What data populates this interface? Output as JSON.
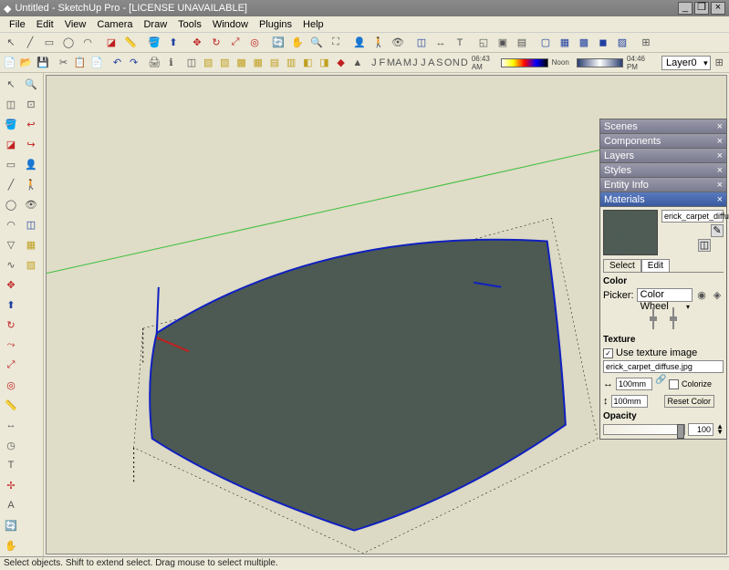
{
  "title": "Untitled - SketchUp Pro - [LICENSE UNAVAILABLE]",
  "menus": [
    "File",
    "Edit",
    "View",
    "Camera",
    "Draw",
    "Tools",
    "Window",
    "Plugins",
    "Help"
  ],
  "shadow": {
    "months": [
      "J",
      "F",
      "M",
      "A",
      "M",
      "J",
      "J",
      "A",
      "S",
      "O",
      "N",
      "D"
    ],
    "time1": "06:43 AM",
    "noon": "Noon",
    "time2": "04:46 PM"
  },
  "layer": {
    "current": "Layer0"
  },
  "panels": {
    "collapsed": [
      "Scenes",
      "Components",
      "Layers",
      "Styles",
      "Entity Info"
    ],
    "materials": {
      "title": "Materials",
      "name": "erick_carpet_diffuse",
      "tabs": [
        "Select",
        "Edit"
      ],
      "color_lbl": "Color",
      "picker_lbl": "Picker:",
      "picker_val": "Color Wheel",
      "texture_lbl": "Texture",
      "use_texture": "Use texture image",
      "texture_file": "erick_carpet_diffuse.jpg",
      "dim_w": "100mm",
      "dim_h": "100mm",
      "colorize": "Colorize",
      "reset": "Reset Color",
      "opacity_lbl": "Opacity",
      "opacity_val": "100"
    }
  },
  "status": "Select objects. Shift to extend select. Drag mouse to select multiple."
}
